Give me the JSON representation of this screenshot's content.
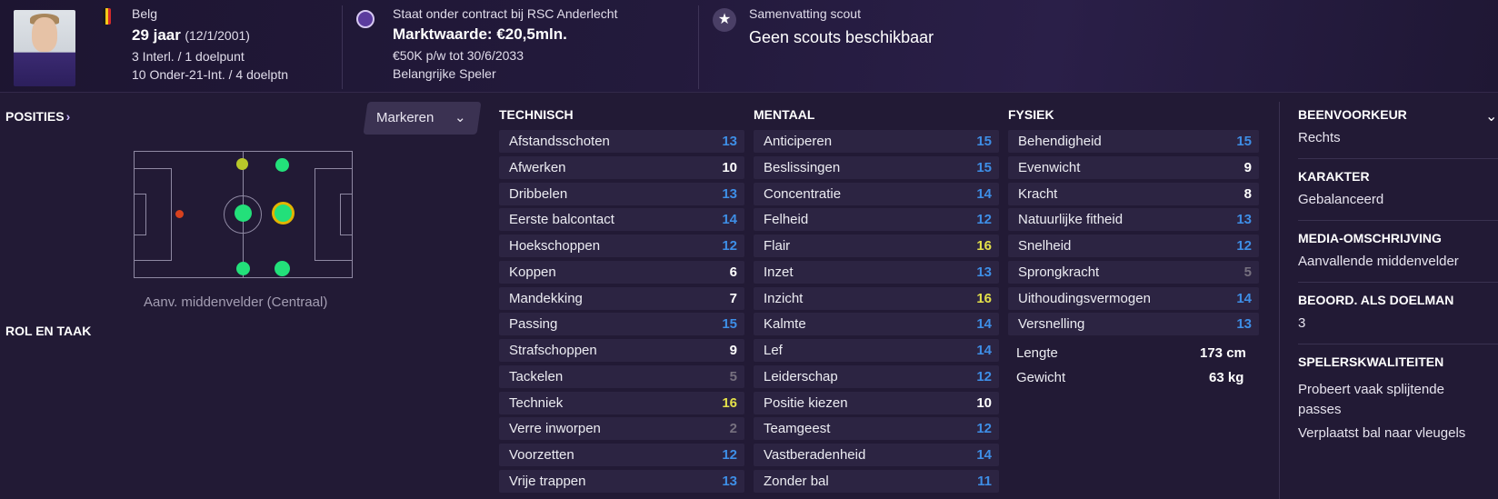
{
  "header": {
    "nationality": "Belg",
    "age": "29 jaar",
    "dob": "(12/1/2001)",
    "caps": "3 Interl. / 1 doelpunt",
    "u21_caps": "10 Onder-21-Int. / 4 doelptn",
    "contract_line": "Staat onder contract bij RSC Anderlecht",
    "market_value": "Marktwaarde: €20,5mln.",
    "wage": "€50K p/w tot 30/6/2033",
    "squad_status": "Belangrijke Speler",
    "scout_title": "Samenvatting scout",
    "scout_value": "Geen scouts beschikbaar",
    "flag_colors": [
      "#1a1a1a",
      "#f5c918",
      "#d42a2a"
    ],
    "star_icon": "star-icon"
  },
  "positions": {
    "title": "POSITIES",
    "chevron": "›",
    "marker_button": "Markeren",
    "marker_chevron": "⌄",
    "caption": "Aanv. middenvelder (Centraal)",
    "role_title": "ROL EN TAAK"
  },
  "technisch": {
    "title": "TECHNISCH",
    "items": [
      {
        "label": "Afstandsschoten",
        "value": "13",
        "color": "blue"
      },
      {
        "label": "Afwerken",
        "value": "10",
        "color": "white"
      },
      {
        "label": "Dribbelen",
        "value": "13",
        "color": "blue"
      },
      {
        "label": "Eerste balcontact",
        "value": "14",
        "color": "blue"
      },
      {
        "label": "Hoekschoppen",
        "value": "12",
        "color": "blue"
      },
      {
        "label": "Koppen",
        "value": "6",
        "color": "white"
      },
      {
        "label": "Mandekking",
        "value": "7",
        "color": "white"
      },
      {
        "label": "Passing",
        "value": "15",
        "color": "blue"
      },
      {
        "label": "Strafschoppen",
        "value": "9",
        "color": "white"
      },
      {
        "label": "Tackelen",
        "value": "5",
        "color": "grey"
      },
      {
        "label": "Techniek",
        "value": "16",
        "color": "yellow"
      },
      {
        "label": "Verre inworpen",
        "value": "2",
        "color": "grey"
      },
      {
        "label": "Voorzetten",
        "value": "12",
        "color": "blue"
      },
      {
        "label": "Vrije trappen",
        "value": "13",
        "color": "blue"
      }
    ]
  },
  "mentaal": {
    "title": "MENTAAL",
    "items": [
      {
        "label": "Anticiperen",
        "value": "15",
        "color": "blue"
      },
      {
        "label": "Beslissingen",
        "value": "15",
        "color": "blue"
      },
      {
        "label": "Concentratie",
        "value": "14",
        "color": "blue"
      },
      {
        "label": "Felheid",
        "value": "12",
        "color": "blue"
      },
      {
        "label": "Flair",
        "value": "16",
        "color": "yellow"
      },
      {
        "label": "Inzet",
        "value": "13",
        "color": "blue"
      },
      {
        "label": "Inzicht",
        "value": "16",
        "color": "yellow"
      },
      {
        "label": "Kalmte",
        "value": "14",
        "color": "blue"
      },
      {
        "label": "Lef",
        "value": "14",
        "color": "blue"
      },
      {
        "label": "Leiderschap",
        "value": "12",
        "color": "blue"
      },
      {
        "label": "Positie kiezen",
        "value": "10",
        "color": "white"
      },
      {
        "label": "Teamgeest",
        "value": "12",
        "color": "blue"
      },
      {
        "label": "Vastberadenheid",
        "value": "14",
        "color": "blue"
      },
      {
        "label": "Zonder bal",
        "value": "11",
        "color": "blue"
      }
    ]
  },
  "fysiek": {
    "title": "FYSIEK",
    "items": [
      {
        "label": "Behendigheid",
        "value": "15",
        "color": "blue"
      },
      {
        "label": "Evenwicht",
        "value": "9",
        "color": "white"
      },
      {
        "label": "Kracht",
        "value": "8",
        "color": "white"
      },
      {
        "label": "Natuurlijke fitheid",
        "value": "13",
        "color": "blue"
      },
      {
        "label": "Snelheid",
        "value": "12",
        "color": "blue"
      },
      {
        "label": "Sprongkracht",
        "value": "5",
        "color": "grey"
      },
      {
        "label": "Uithoudingsvermogen",
        "value": "14",
        "color": "blue"
      },
      {
        "label": "Versnelling",
        "value": "13",
        "color": "blue"
      }
    ],
    "height_label": "Lengte",
    "height_value": "173 cm",
    "weight_label": "Gewicht",
    "weight_value": "63 kg"
  },
  "right_panel": {
    "foot_title": "BEENVOORKEUR",
    "foot_value": "Rechts",
    "collapse_chevron": "⌄",
    "character_title": "KARAKTER",
    "character_value": "Gebalanceerd",
    "media_title": "MEDIA-OMSCHRIJVING",
    "media_value": "Aanvallende middenvelder",
    "gk_title": "BEOORD. ALS DOELMAN",
    "gk_value": "3",
    "traits_title": "SPELERSKWALITEITEN",
    "trait1_line1": "Probeert vaak splijtende",
    "trait1_line2": "passes",
    "trait2": "Verplaatst bal naar vleugels"
  },
  "colors": {
    "blue": "#3e8ee6",
    "yellow": "#e3e04a",
    "white": "#ffffff",
    "grey": "#76707f",
    "position_green": "#23e07a",
    "position_yellowgreen": "#b8c82a",
    "position_red": "#d8411e"
  }
}
